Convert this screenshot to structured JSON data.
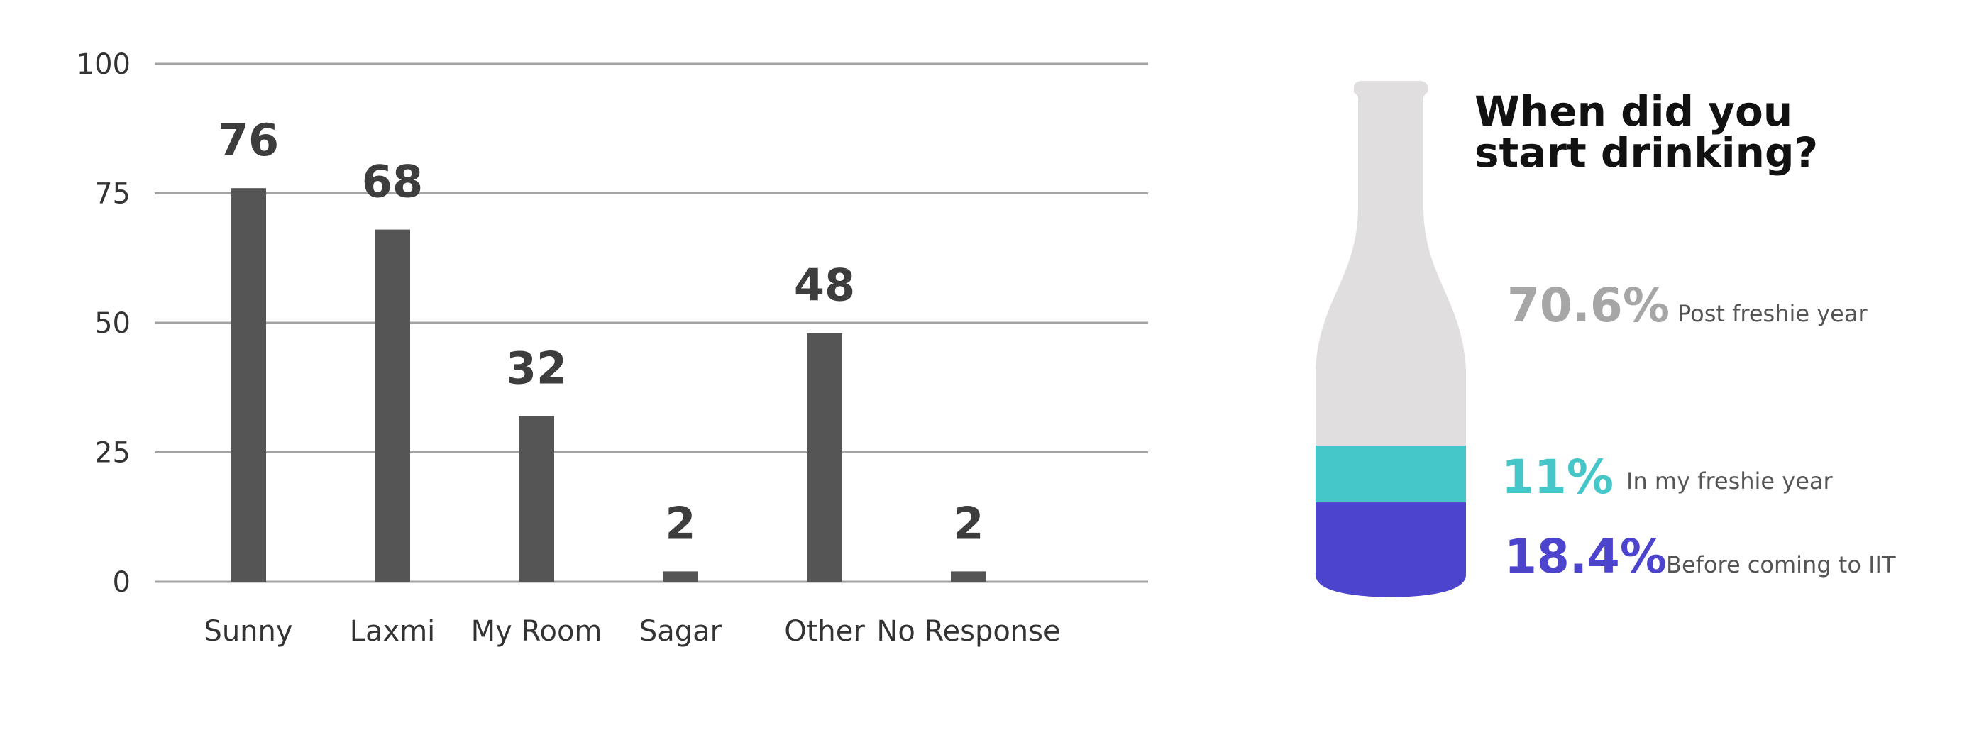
{
  "chart_data": [
    {
      "type": "bar",
      "categories": [
        "Sunny",
        "Laxmi",
        "My Room",
        "Sagar",
        "Other",
        "No Response"
      ],
      "values": [
        76,
        68,
        32,
        2,
        48,
        2
      ],
      "data_labels": [
        "76",
        "68",
        "32",
        "2",
        "48",
        "2"
      ],
      "yticks": [
        "0",
        "25",
        "50",
        "75",
        "100"
      ],
      "ylim": [
        0,
        100
      ],
      "grid": true,
      "bar_color": "#555555",
      "title": "",
      "xlabel": "",
      "ylabel": ""
    },
    {
      "type": "bar",
      "orientation": "stacked-vertical",
      "title": "When did you start drinking?",
      "title_lines": [
        "When did you",
        "start drinking?"
      ],
      "segments": [
        {
          "value": 18.4,
          "label": "18.4%",
          "description": "Before coming to IIT",
          "color": "#4c44cc"
        },
        {
          "value": 11,
          "label": "11%",
          "description": "In my freshie year",
          "color": "#45c6c9"
        },
        {
          "value": 70.6,
          "label": "70.6%",
          "description": "Post freshie year",
          "color": "#e0dede"
        }
      ],
      "label_colors": {
        "post": "#a6a6a6",
        "freshie": "#45c6c9",
        "before": "#4c44cc"
      }
    }
  ]
}
